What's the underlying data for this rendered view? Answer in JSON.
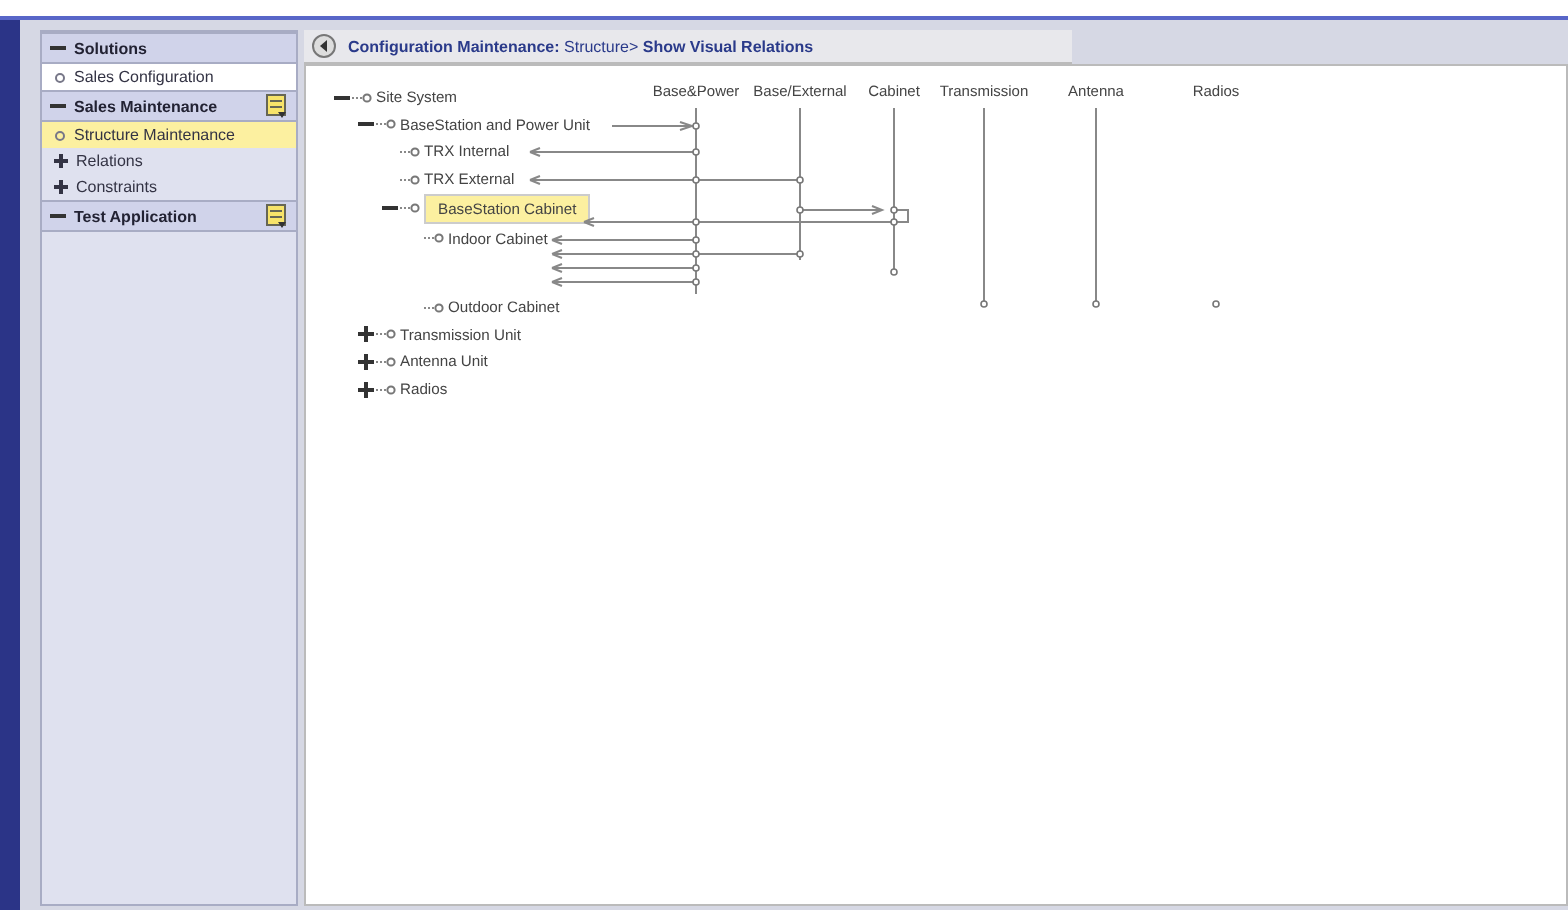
{
  "sidebar": {
    "sections": [
      {
        "title": "Solutions",
        "expanded": true,
        "items": [
          {
            "label": "Sales Configuration",
            "selected": false,
            "kind": "dot"
          }
        ]
      },
      {
        "title": "Sales Maintenance",
        "expanded": true,
        "menu_icon": true,
        "items": [
          {
            "label": "Structure Maintenance",
            "selected": true,
            "kind": "dot"
          },
          {
            "label": "Relations",
            "selected": false,
            "kind": "plus"
          },
          {
            "label": "Constraints",
            "selected": false,
            "kind": "plus"
          }
        ]
      },
      {
        "title": "Test Application",
        "expanded": true,
        "menu_icon": true
      }
    ]
  },
  "header": {
    "title": "**Configuration Maintenance:** Structure> **Show Visual Relations**"
  },
  "relation_columns": [
    "Base&Power",
    "Base/External",
    "Cabinet",
    "Transmission",
    "Antenna",
    "Radios"
  ],
  "tree": [
    {
      "label": "Site System",
      "expanded": true,
      "selected": false,
      "children": [
        {
          "label": "BaseStation and Power Unit",
          "expanded": true,
          "selected": false,
          "children": [
            {
              "label": "TRX Internal",
              "selected": false
            },
            {
              "label": "TRX External",
              "selected": false
            },
            {
              "label": "BaseStation Cabinet",
              "expanded": true,
              "selected": true,
              "children": [
                {
                  "label": "Indoor Cabinet",
                  "selected": false
                },
                {
                  "label": "Outdoor Cabinet",
                  "selected": false
                }
              ]
            }
          ]
        },
        {
          "label": "Transmission Unit",
          "expanded": false,
          "selected": false
        },
        {
          "label": "Antenna Unit",
          "expanded": false,
          "selected": false
        },
        {
          "label": "Radios",
          "expanded": false,
          "selected": false
        }
      ]
    }
  ]
}
